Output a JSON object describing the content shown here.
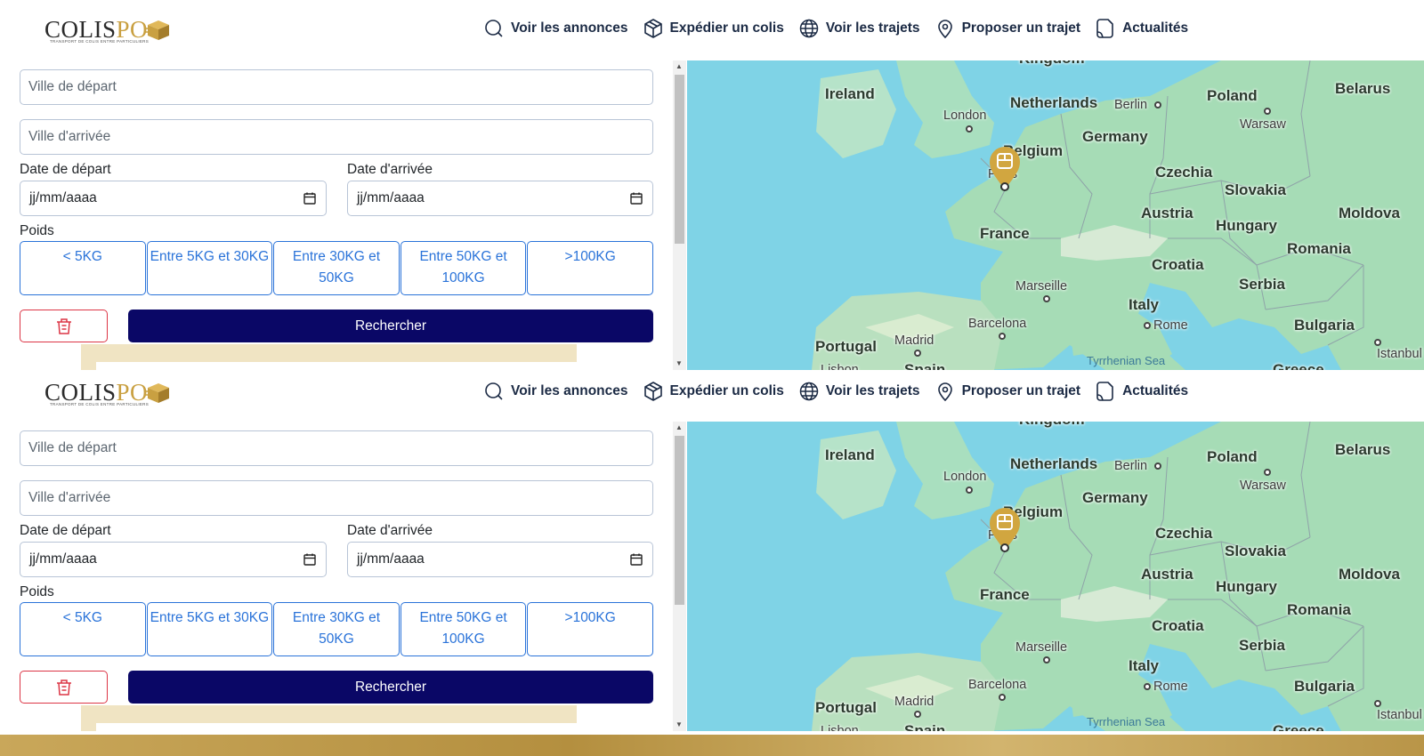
{
  "brand": {
    "name_dark": "COLIS",
    "name_gold": "PO",
    "tagline": "TRANSPORT DE COLIS ENTRE PARTICULIERS"
  },
  "nav": [
    {
      "label": "Voir les annonces",
      "icon": "search-icon"
    },
    {
      "label": "Expédier un colis",
      "icon": "package-icon"
    },
    {
      "label": "Voir les trajets",
      "icon": "globe-icon"
    },
    {
      "label": "Proposer un trajet",
      "icon": "map-pin-icon"
    },
    {
      "label": "Actualités",
      "icon": "document-icon"
    }
  ],
  "form": {
    "departure_city_placeholder": "Ville de départ",
    "arrival_city_placeholder": "Ville d'arrivée",
    "departure_date_label": "Date de départ",
    "arrival_date_label": "Date d'arrivée",
    "date_placeholder": "jj/mm/aaaa",
    "weight_label": "Poids",
    "weights": [
      "< 5KG",
      "Entre 5KG et 30KG",
      "Entre 30KG et 50KG",
      "Entre 50KG et 100KG",
      ">100KG"
    ],
    "search_label": "Rechercher"
  },
  "map": {
    "countries": [
      "Ireland",
      "Netherlands",
      "Poland",
      "Belarus",
      "Germany",
      "Belgium",
      "Czechia",
      "Slovakia",
      "Austria",
      "Moldova",
      "France",
      "Hungary",
      "Romania",
      "Croatia",
      "Serbia",
      "Italy",
      "Bulgaria",
      "Portugal",
      "Spain",
      "Greece",
      "Kingdom"
    ],
    "cities": [
      "London",
      "Berlin",
      "Warsaw",
      "Paris",
      "Marseille",
      "Barcelona",
      "Madrid",
      "Rome",
      "Istanbul",
      "Lisbon"
    ],
    "seas": [
      "Tyrrhenian Sea"
    ],
    "marker_icon": "package-marker-icon"
  },
  "colors": {
    "accent_blue": "#2a73d9",
    "primary_navy": "#0a0766",
    "danger": "#dc3545",
    "gold": "#c9a041"
  }
}
